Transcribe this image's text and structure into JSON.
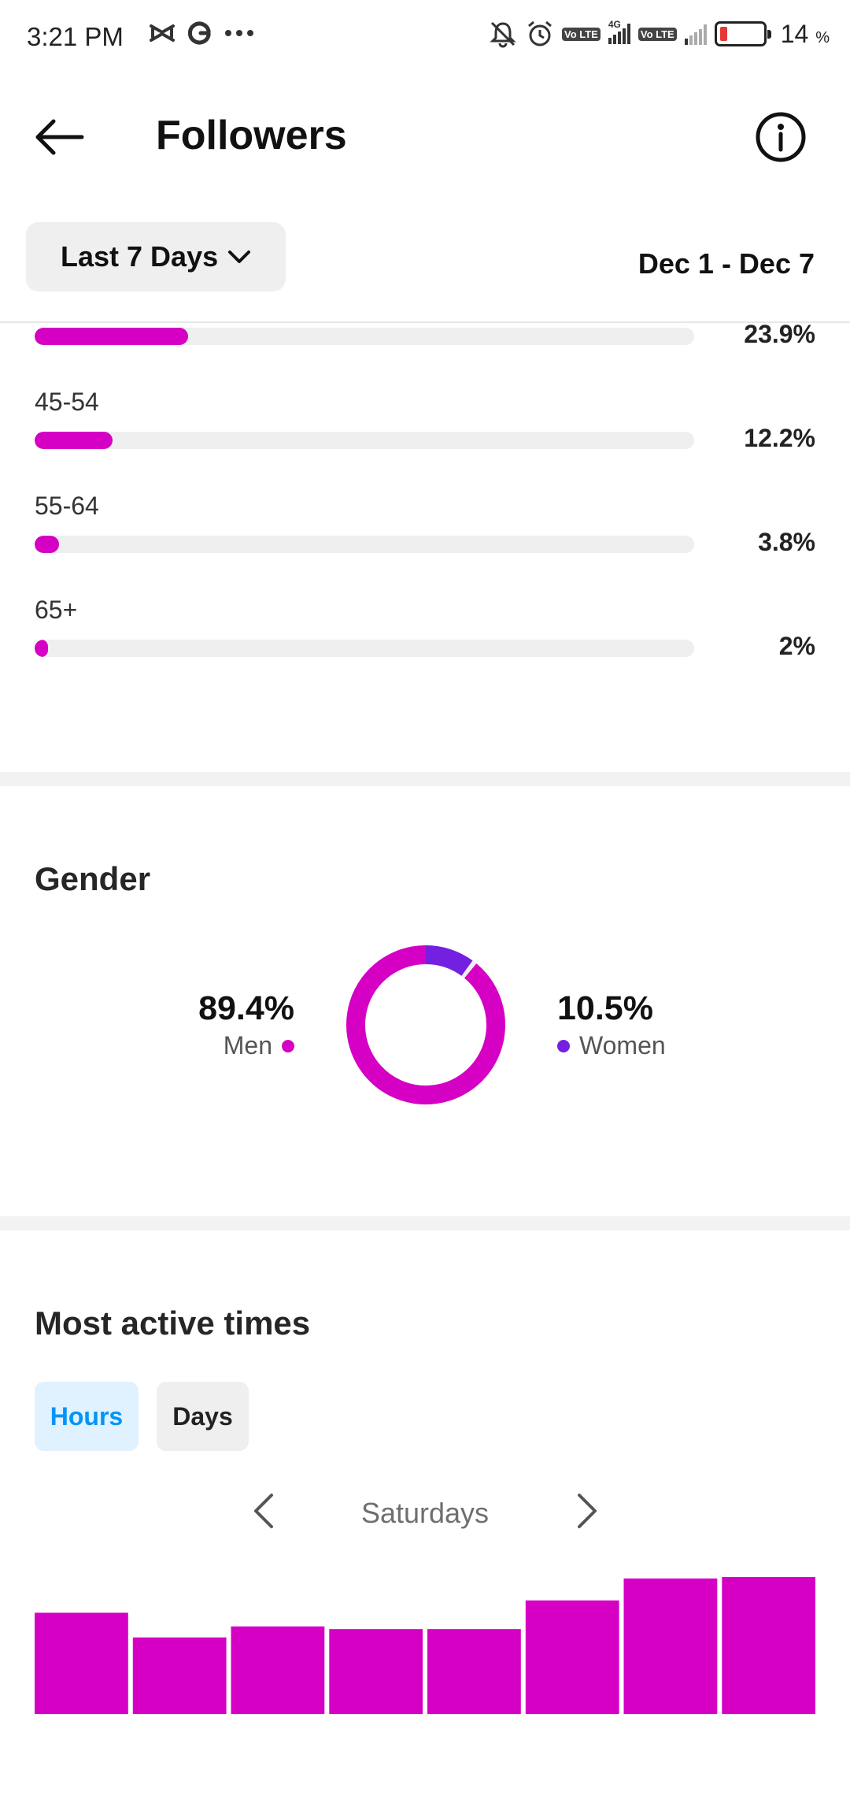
{
  "status_bar": {
    "time": "3:21 PM",
    "left_icons": [
      "capcut-icon",
      "google-icon",
      "more-icon"
    ],
    "right_icons": [
      "mute-icon",
      "alarm-icon",
      "volte-icon",
      "signal-4g-icon",
      "volte-icon",
      "signal-icon"
    ],
    "battery_percent": "14",
    "battery_unit": "%",
    "network_label": "4G",
    "volte_label": "Vo LTE"
  },
  "header": {
    "title": "Followers",
    "back_icon": "arrow-left-icon",
    "info_icon": "info-icon"
  },
  "filters": {
    "range_label": "Last 7 Days",
    "date_range": "Dec 1 - Dec 7"
  },
  "age_ranges": [
    {
      "label": "",
      "percent_text": "23.9%",
      "value": 23.9
    },
    {
      "label": "45-54",
      "percent_text": "12.2%",
      "value": 12.2
    },
    {
      "label": "55-64",
      "percent_text": "3.8%",
      "value": 3.8
    },
    {
      "label": "65+",
      "percent_text": "2%",
      "value": 2
    }
  ],
  "gender": {
    "title": "Gender",
    "men": {
      "value_text": "89.4%",
      "label": "Men",
      "value": 89.4,
      "color": "#d600c5"
    },
    "women": {
      "value_text": "10.5%",
      "label": "Women",
      "value": 10.5,
      "color": "#7420e0"
    }
  },
  "active_times": {
    "title": "Most active times",
    "tabs": [
      {
        "label": "Hours",
        "selected": true
      },
      {
        "label": "Days",
        "selected": false
      }
    ],
    "day_label": "Saturdays",
    "prev_icon": "chevron-left-icon",
    "next_icon": "chevron-right-icon"
  },
  "chart_data": {
    "type": "bar",
    "title": "",
    "xlabel": "",
    "ylabel": "",
    "values": [
      74,
      56,
      64,
      62,
      62,
      83,
      99,
      100
    ],
    "color": "#d600c5"
  },
  "colors": {
    "accent": "#d600c5",
    "accent_secondary": "#7420e0",
    "link_blue": "#0095f6"
  }
}
